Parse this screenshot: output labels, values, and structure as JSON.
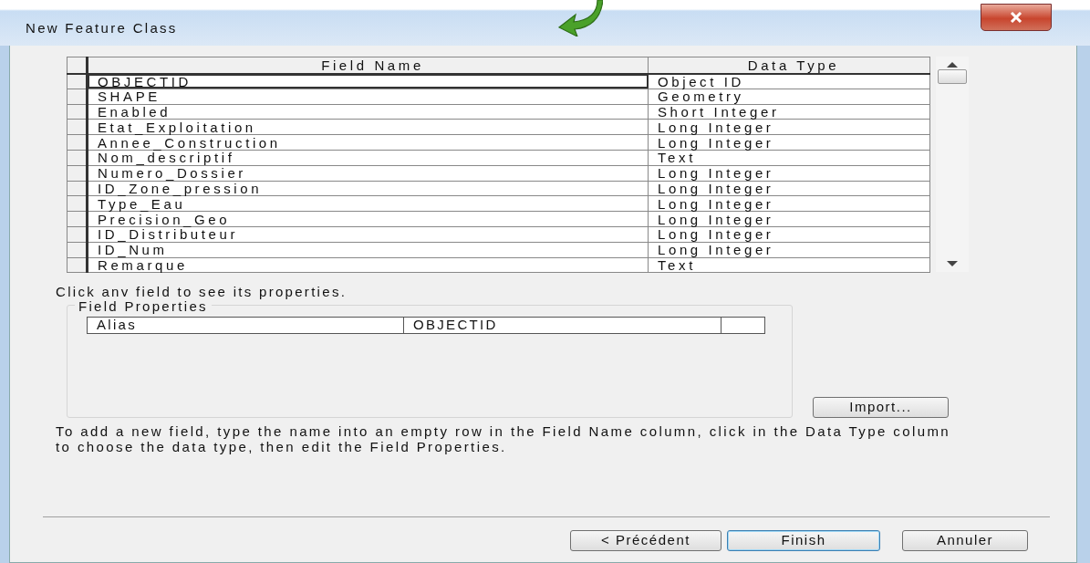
{
  "window": {
    "title": "New Feature Class"
  },
  "fields_table": {
    "columns": [
      "Field Name",
      "Data Type"
    ],
    "rows": [
      {
        "field_name": "OBJECTID",
        "data_type": "Object ID",
        "selected": true
      },
      {
        "field_name": "SHAPE",
        "data_type": "Geometry",
        "selected": false
      },
      {
        "field_name": "Enabled",
        "data_type": "Short Integer",
        "selected": false
      },
      {
        "field_name": "Etat_Exploitation",
        "data_type": "Long Integer",
        "selected": false
      },
      {
        "field_name": "Annee_Construction",
        "data_type": "Long Integer",
        "selected": false
      },
      {
        "field_name": "Nom_descriptif",
        "data_type": "Text",
        "selected": false
      },
      {
        "field_name": "Numero_Dossier",
        "data_type": "Long Integer",
        "selected": false
      },
      {
        "field_name": "ID_Zone_pression",
        "data_type": "Long Integer",
        "selected": false
      },
      {
        "field_name": "Type_Eau",
        "data_type": "Long Integer",
        "selected": false
      },
      {
        "field_name": "Precision_Geo",
        "data_type": "Long Integer",
        "selected": false
      },
      {
        "field_name": "ID_Distributeur",
        "data_type": "Long Integer",
        "selected": false
      },
      {
        "field_name": "ID_Num",
        "data_type": "Long Integer",
        "selected": false
      },
      {
        "field_name": "Remarque",
        "data_type": "Text",
        "selected": false
      }
    ]
  },
  "hint": "Click any field to see its properties.",
  "field_properties": {
    "title": "Field Properties",
    "rows": [
      {
        "property": "Alias",
        "value": "OBJECTID"
      }
    ]
  },
  "import_button": "Import...",
  "instructions": "To add a new field, type the name into an empty row in the Field Name column, click in the Data Type column to choose the data type, then edit the Field Properties.",
  "buttons": [
    {
      "label": "< Précédent",
      "default": false
    },
    {
      "label": "Finish",
      "default": true
    },
    {
      "label": "Annuler",
      "default": false
    }
  ]
}
